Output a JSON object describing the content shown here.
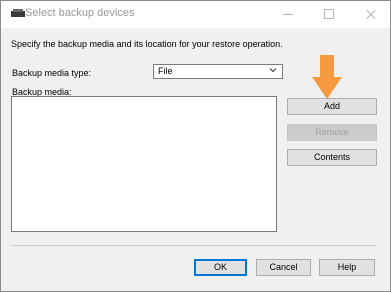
{
  "window": {
    "title": "Select backup devices"
  },
  "instructions": "Specify the backup media and its location for your restore operation.",
  "media_type": {
    "label": "Backup media type:",
    "value": "File"
  },
  "media": {
    "label": "Backup media:",
    "items": []
  },
  "buttons": {
    "add": "Add",
    "remove": "Remove",
    "contents": "Contents",
    "ok": "OK",
    "cancel": "Cancel",
    "help": "Help"
  },
  "colors": {
    "accent": "#0078d7",
    "arrow": "#f79a3e"
  },
  "icons": {
    "app": "drive-icon",
    "minimize": "minimize-icon",
    "maximize": "maximize-icon",
    "close": "close-icon",
    "dropdown": "chevron-down-icon",
    "callout": "arrow-down-icon"
  }
}
